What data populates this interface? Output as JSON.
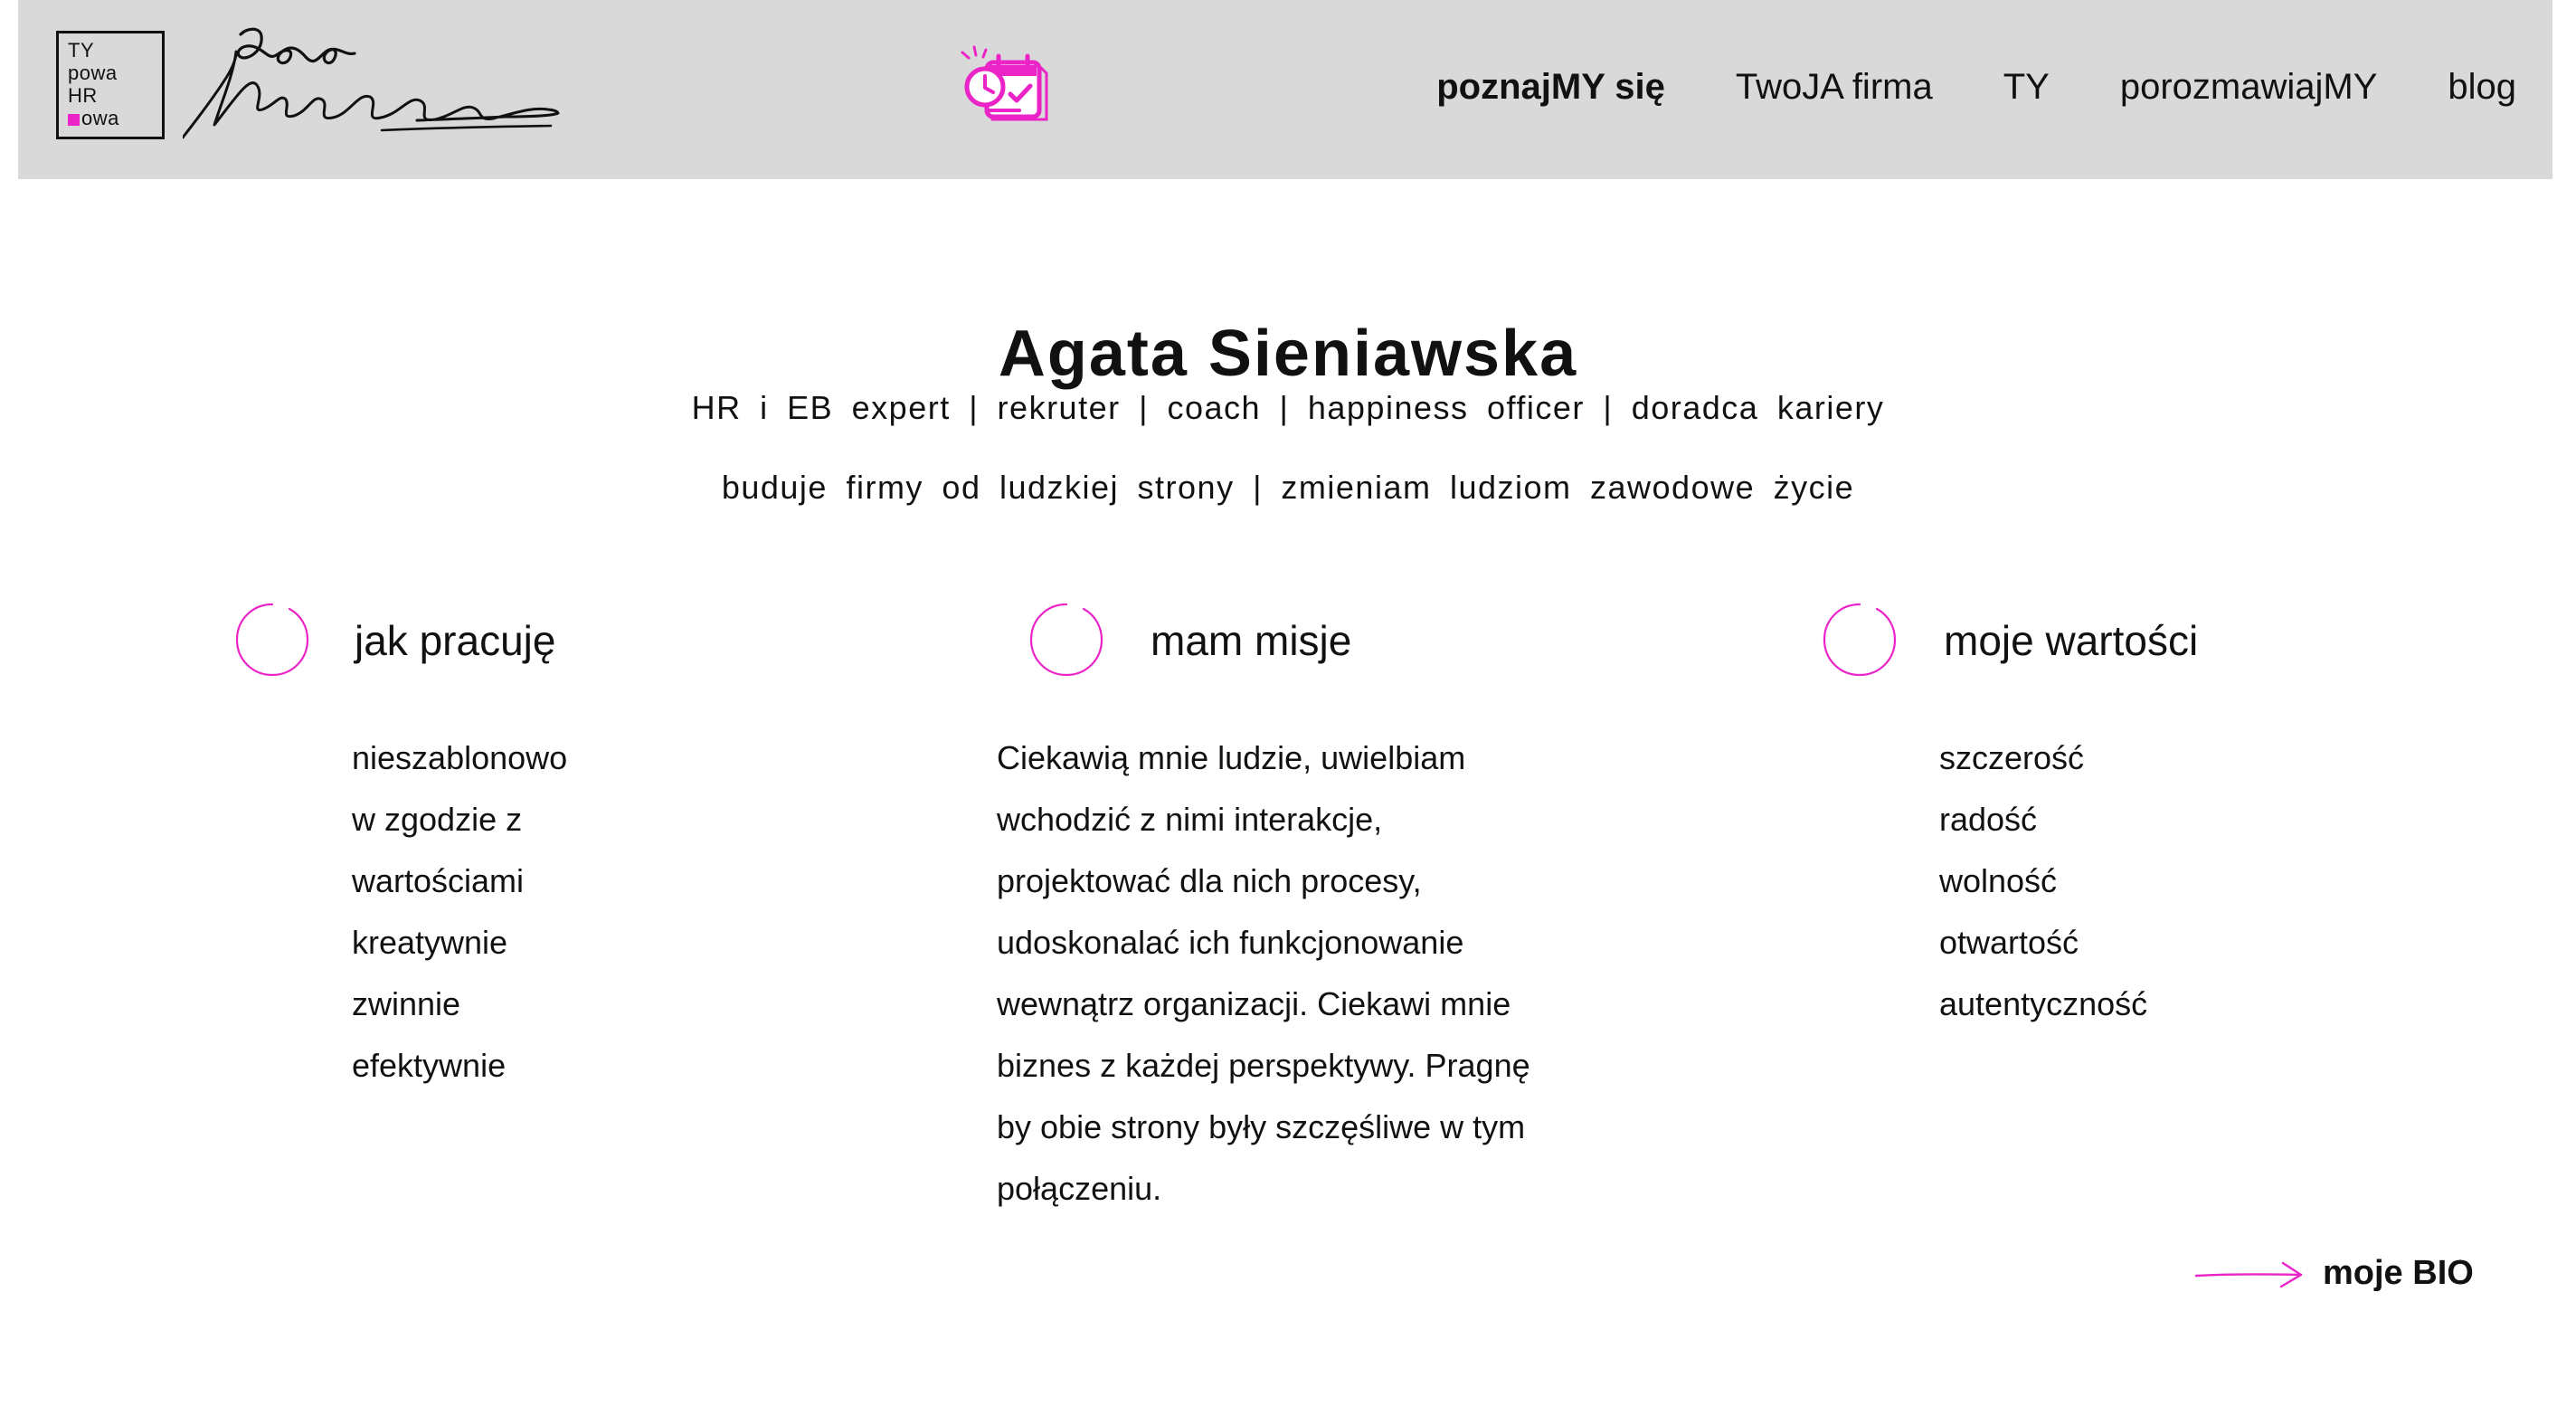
{
  "logo": {
    "lines": [
      "TY",
      "powa",
      "HR",
      "owa"
    ]
  },
  "header": {
    "brand_signature": "Agata Sieniawska",
    "nav": [
      {
        "label": "poznajMY się",
        "active": true
      },
      {
        "label": "TwoJA firma",
        "active": false
      },
      {
        "label": "TY",
        "active": false
      },
      {
        "label": "porozmawiajMY",
        "active": false
      },
      {
        "label": "blog",
        "active": false
      }
    ]
  },
  "hero": {
    "title": "Agata Sieniawska",
    "subtitle_line_1": "HR i EB expert | rekruter | coach | happiness officer | doradca kariery",
    "subtitle_line_2": "buduje firmy od ludzkiej strony | zmieniam ludziom zawodowe życie"
  },
  "sections": [
    {
      "heading": "jak pracuję",
      "items": [
        "nieszablonowo",
        "w zgodzie z",
        "wartościami",
        "kreatywnie",
        "zwinnie",
        "efektywnie"
      ]
    },
    {
      "heading": "mam misje",
      "lines": [
        "Ciekawią mnie ludzie, uwielbiam",
        "wchodzić z nimi interakcje,",
        "projektować dla nich procesy,",
        "udoskonalać ich funkcjonowanie",
        "wewnątrz organizacji. Ciekawi mnie",
        "biznes z każdej perspektywy. Pragnę",
        "by obie strony były szczęśliwe w tym",
        "połączeniu."
      ]
    },
    {
      "heading": "moje wartości",
      "items": [
        "szczerość",
        "radość",
        "wolność",
        "otwartość",
        "autentyczność"
      ]
    }
  ],
  "cta": {
    "label": "moje BIO"
  },
  "icons": {
    "calendar": "calendar-clock-icon",
    "ring": "circle-ring-icon",
    "arrow": "arrow-right-icon"
  },
  "colors": {
    "header_background": "#d9d9d9",
    "accent": "#ea24c7",
    "text": "#111111"
  }
}
